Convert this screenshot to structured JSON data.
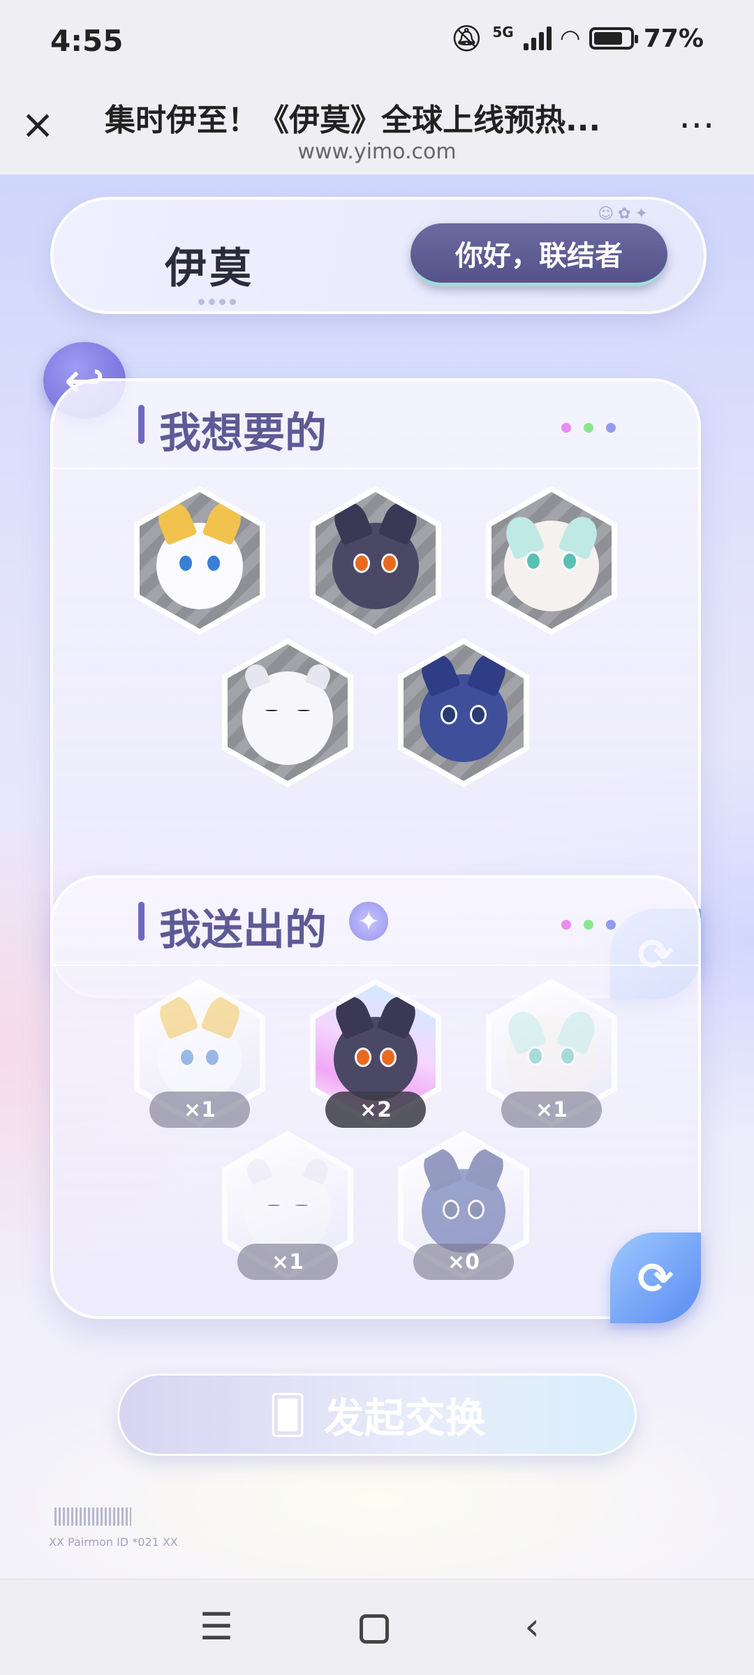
{
  "status_bar": {
    "time": "4:55",
    "network": "5G",
    "battery": "77%",
    "battery_level": 0.77,
    "icons": [
      "mute-icon",
      "signal-icon",
      "wifi-icon",
      "battery-icon"
    ]
  },
  "browser": {
    "title": "集时伊至！《伊莫》全球上线预热...",
    "url": "www.yimo.com",
    "close_icon": "×",
    "more_icon": "⋯"
  },
  "banner": {
    "logo": "伊莫",
    "greeting": "你好，联结者"
  },
  "want_section": {
    "title": "我想要的",
    "dot_colors": [
      "#e98bef",
      "#8be68f",
      "#8f9df0"
    ],
    "pets": [
      "golden-white-pet",
      "dark-fox-pet",
      "fluffy-sheep-pet",
      "white-otter-pet",
      "blue-squirrel-pet"
    ]
  },
  "give_section": {
    "title": "我送出的",
    "dot_colors": [
      "#e98bef",
      "#8be68f",
      "#8f9df0"
    ],
    "items": [
      {
        "pet": "golden-white-pet",
        "count": "×1",
        "active": false
      },
      {
        "pet": "dark-fox-pet",
        "count": "×2",
        "active": true
      },
      {
        "pet": "fluffy-sheep-pet",
        "count": "×1",
        "active": false
      },
      {
        "pet": "white-otter-pet",
        "count": "×1",
        "active": false
      },
      {
        "pet": "blue-squirrel-pet",
        "count": "×0",
        "active": false
      }
    ]
  },
  "swap_button": {
    "label": "发起交换"
  },
  "footer": {
    "tag": "XX Pairmon ID *021 XX"
  },
  "colors": {
    "accent": "#6b66d6",
    "refresh": "#5b8af0",
    "greet_bg": "#54528a"
  }
}
